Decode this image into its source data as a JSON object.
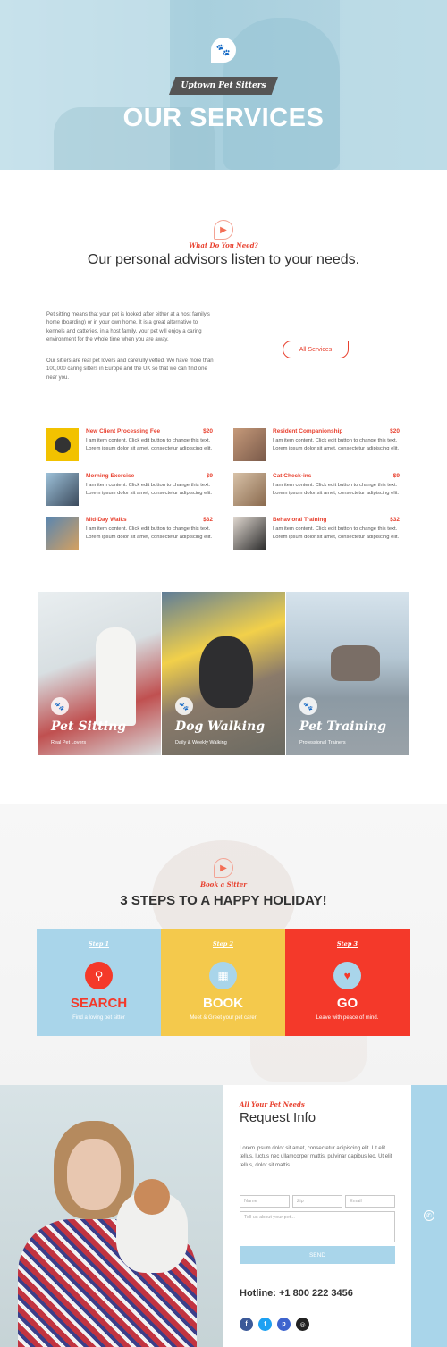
{
  "hero": {
    "tagline": "Uptown Pet Sitters",
    "title": "OUR SERVICES"
  },
  "intro": {
    "subheading": "What Do You Need?",
    "heading": "Our personal advisors listen to your needs.",
    "paragraph1": "Pet sitting means that your pet is looked after either at a host family's home (boarding) or in your own home. It is a great alternative to kennels and catteries, in a host family, your pet will enjoy a caring environment for the whole time when you are away.",
    "paragraph2": "Our sitters are real pet lovers and carefully vetted. We have more than 100,000 caring sitters in Europe and the UK so that we can find one near you.",
    "button": "All Services"
  },
  "menu": [
    {
      "title": "New Client Processing Fee",
      "price": "$20",
      "desc": "I am item content. Click edit button to change this text. Lorem ipsum dolor sit amet, consectetur adipiscing elit."
    },
    {
      "title": "Resident Companionship",
      "price": "$20",
      "desc": "I am item content. Click edit button to change this text. Lorem ipsum dolor sit amet, consectetur adipiscing elit."
    },
    {
      "title": "Morning Exercise",
      "price": "$9",
      "desc": "I am item content. Click edit button to change this text. Lorem ipsum dolor sit amet, consectetur adipiscing elit."
    },
    {
      "title": "Cat Check-ins",
      "price": "$9",
      "desc": "I am item content. Click edit button to change this text. Lorem ipsum dolor sit amet, consectetur adipiscing elit."
    },
    {
      "title": "Mid-Day Walks",
      "price": "$32",
      "desc": "I am item content. Click edit button to change this text. Lorem ipsum dolor sit amet, consectetur adipiscing elit."
    },
    {
      "title": "Behavioral Training",
      "price": "$32",
      "desc": "I am item content. Click edit button to change this text. Lorem ipsum dolor sit amet, consectetur adipiscing elit."
    }
  ],
  "cards": [
    {
      "title": "Pet Sitting",
      "subtitle": "Real Pet Lovers"
    },
    {
      "title": "Dog Walking",
      "subtitle": "Daily & Weekly Walking"
    },
    {
      "title": "Pet Training",
      "subtitle": "Professional Trainers"
    }
  ],
  "steps_section": {
    "subheading": "Book a Sitter",
    "heading": "3 STEPS TO A HAPPY HOLIDAY!",
    "steps": [
      {
        "label": "Step 1",
        "title": "SEARCH",
        "text": "Find a loving pet sitter",
        "color": "#a9d5ea"
      },
      {
        "label": "Step 2",
        "title": "BOOK",
        "text": "Meet & Greet your pet carer",
        "color": "#f4c94c"
      },
      {
        "label": "Step 3",
        "title": "GO",
        "text": "Leave with peace of mind.",
        "color": "#f4392a"
      }
    ]
  },
  "request": {
    "subheading": "All Your Pet Needs",
    "heading": "Request Info",
    "paragraph": "Lorem ipsum dolor sit amet, consectetur adipiscing elit. Ut elit tellus, luctus nec ullamcorper mattis, pulvinar dapibus leo. Ut elit tellus, dolor sit mattis.",
    "name_placeholder": "Name",
    "zip_placeholder": "Zip",
    "email_placeholder": "Email",
    "message_placeholder": "Tell us about your pet...",
    "send_button": "SEND",
    "hotline": "Hotline: +1 800 222 3456"
  },
  "social": [
    "f",
    "t",
    "p",
    "◎"
  ],
  "colors": {
    "accent_red": "#e8412f",
    "light_blue": "#a9d5ea",
    "yellow": "#f4c94c",
    "facebook": "#3b5998",
    "twitter": "#1da1f2",
    "pinterest": "#3e64ce",
    "instagram": "#222222"
  }
}
